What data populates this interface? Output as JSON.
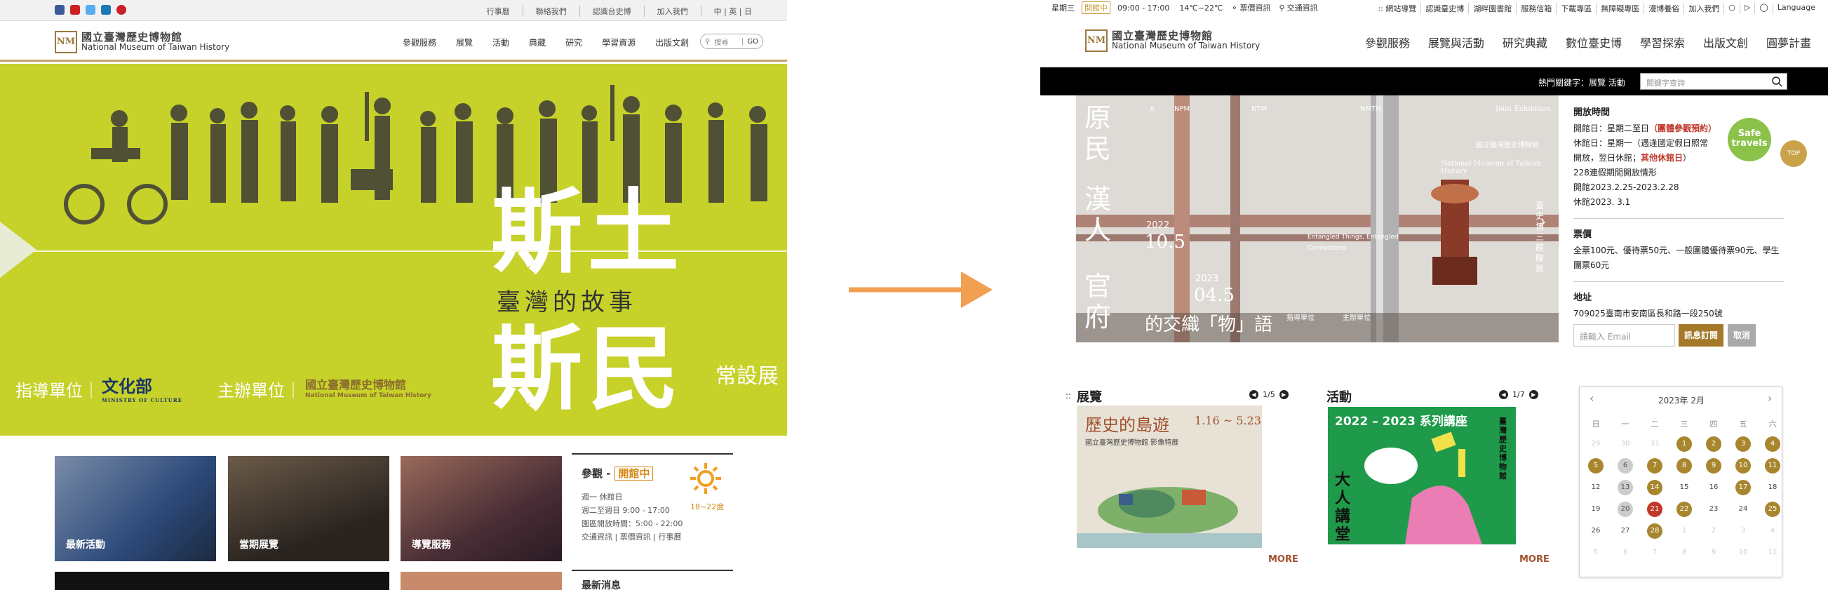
{
  "old_site": {
    "social_icons": [
      "facebook-icon",
      "youtube-icon",
      "twitter-icon",
      "vimeo-icon",
      "pinterest-icon"
    ],
    "social_colors": [
      "#3b5998",
      "#cc2020",
      "#55acee",
      "#1a7ab5",
      "#cb2027"
    ],
    "top_links": [
      "行事曆",
      "聯絡我們",
      "認識台史博",
      "加入我們",
      "中 | 英 | 日"
    ],
    "logo_mark": "NM",
    "logo_zh": "國立臺灣歷史博物館",
    "logo_en": "National Museum of Taiwan History",
    "nav": [
      "參觀服務",
      "展覽",
      "活動",
      "典藏",
      "研究",
      "學習資源",
      "出版文創"
    ],
    "search_placeholder": "搜尋",
    "search_go": "GO",
    "hero": {
      "title_1": "斯土",
      "title_2": "斯民",
      "subtitle": "臺灣的故事",
      "permanent": "常設展",
      "guide_label": "指導單位｜",
      "guide_org": "文化部",
      "guide_org_en": "MINISTRY OF CULTURE",
      "host_label": "主辦單位｜",
      "host_org": "國立臺灣歷史博物館",
      "host_org_en": "National Museum of Taiwan History",
      "bg_color": "#c6d12a"
    },
    "tiles": [
      "最新活動",
      "當期展覽",
      "導覽服務"
    ],
    "visit": {
      "title": "參觀 -",
      "status": "開館中",
      "lines": [
        "週一 休館日",
        "週二至週日 9:00 - 17:00",
        "園區開放時間：5:00 - 22:00",
        "交通資訊 | 票價資訊 | 行事曆"
      ],
      "temp": "18~22度"
    },
    "news_title": "最新消息"
  },
  "new_site": {
    "topbar": {
      "weekday": "星期三",
      "status": "開館中",
      "hours": "09:00 - 17:00",
      "temp": "14℃~22℃",
      "ticket": "票價資訊",
      "traffic": "交通資訊",
      "links": [
        "::  網站導覽",
        "認識臺史博",
        "湖畔園書館",
        "服務信箱",
        "下載專區",
        "無障礙專區",
        "漫博養俗",
        "加入我們"
      ],
      "language": "Language"
    },
    "logo_mark": "NM",
    "logo_zh": "國立臺灣歷史博物館",
    "logo_en": "National Museum of Taiwan History",
    "nav": [
      "參觀服務",
      "展覽與活動",
      "研究典藏",
      "數位臺史博",
      "學習探索",
      "出版文創",
      "圓夢計畫"
    ],
    "hot_keywords": "熱門關鍵字：展覽 活動",
    "search_placeholder": "關鍵字查詢",
    "banner": {
      "vertical_1": "原民",
      "vertical_2": "漢人",
      "vertical_3": "官府",
      "tagline": "的交織「物」語",
      "start_year": "2022",
      "start_date": "10.5",
      "end_year": "2023",
      "end_date": "04.5",
      "en_title": "Entangled Things, Entangled Connections",
      "museum_zh": "國立臺灣歷史博物館",
      "museum_en": "National Museum of Taiwan History",
      "side_text": "臺史博三館聯展",
      "labels": [
        "A",
        "NPM",
        "NTM",
        "NMTH",
        "Joint Exhibition"
      ],
      "orgs": [
        "指導單位",
        "主辦單位"
      ]
    },
    "info": {
      "hours_title": "開放時間",
      "open": "開館日：星期二至日",
      "open_note": "（團體參觀預約）",
      "closed": "休館日：星期一（遇逢國定假日照常開放，翌日休館；",
      "closed_note": "其他休館日",
      "closed_end": "）",
      "special_1": "228連假期間開放情形",
      "special_2": "開館2023.2.25-2023.2.28",
      "special_3": "休館2023. 3.1",
      "ticket_title": "票價",
      "ticket": "全票100元、優待票50元、一般團體優待票90元、學生團票60元",
      "address_title": "地址",
      "address": "709025臺南市安南區長和路一段250號",
      "email_placeholder": "請輸入 Email",
      "subscribe": "訊息訂閱",
      "cancel": "取消"
    },
    "safe_travels": "Safe travels",
    "top_btn": "TOP",
    "exhibit": {
      "title": "展覽",
      "pager": "1/5",
      "poster_title": "歷史的島遊",
      "poster_sub": "國立臺灣歷史博物館 影像特展",
      "poster_dates": "1.16 ~ 5.23",
      "more": "MORE"
    },
    "activity": {
      "title": "活動",
      "pager": "1/7",
      "poster_title": "2022 – 2023 系列講座",
      "poster_big": "大人講堂",
      "poster_side": "臺灣歷史博物館",
      "more": "MORE"
    },
    "calendar": {
      "title": "2023年  2月",
      "weekdays": [
        "日",
        "一",
        "二",
        "三",
        "四",
        "五",
        "六"
      ],
      "days": [
        "29",
        "30",
        "31",
        "1",
        "2",
        "3",
        "4",
        "5",
        "6",
        "7",
        "8",
        "9",
        "10",
        "11",
        "12",
        "13",
        "14",
        "15",
        "16",
        "17",
        "18",
        "19",
        "20",
        "21",
        "22",
        "23",
        "24",
        "25",
        "26",
        "27",
        "28",
        "1",
        "2",
        "3",
        "4",
        "5",
        "6",
        "7",
        "8",
        "9",
        "10",
        "11"
      ]
    },
    "accent": "#c9a24a"
  },
  "arrow_color": "#f0a050"
}
